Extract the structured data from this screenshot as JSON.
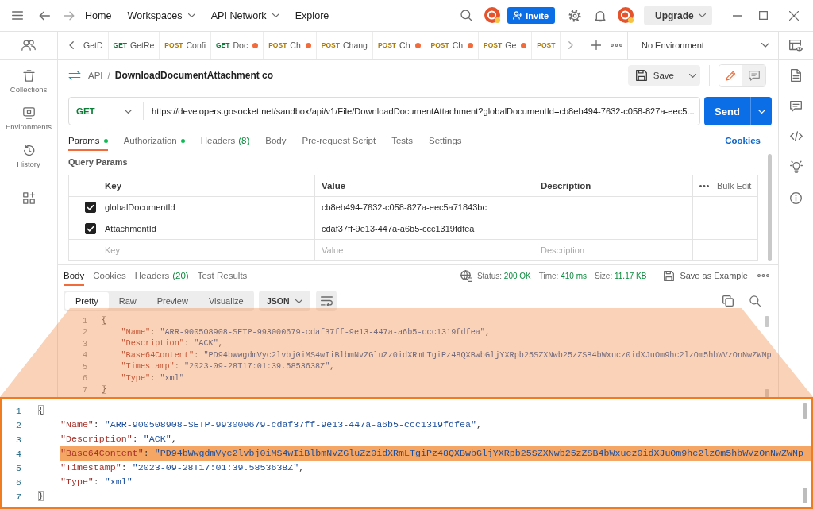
{
  "title_bar": {
    "nav": [
      {
        "label": "Home",
        "dropdown": false
      },
      {
        "label": "Workspaces",
        "dropdown": true
      },
      {
        "label": "API Network",
        "dropdown": true
      },
      {
        "label": "Explore",
        "dropdown": false
      }
    ],
    "invite_button": "Invite",
    "upgrade_button": "Upgrade"
  },
  "left_sidebar": {
    "items": [
      {
        "label": "Collections"
      },
      {
        "label": "Environments"
      },
      {
        "label": "History"
      }
    ]
  },
  "open_tabs": [
    {
      "name": "GetD",
      "modified": false
    },
    {
      "method": "GET",
      "kind": "get",
      "name": "GetRe",
      "modified": false
    },
    {
      "method": "POST",
      "kind": "post",
      "name": "Confi",
      "modified": false
    },
    {
      "method": "GET",
      "kind": "get",
      "name": "Doc",
      "modified": true
    },
    {
      "method": "POST",
      "kind": "post",
      "name": "Ch",
      "modified": true
    },
    {
      "method": "POST",
      "kind": "post",
      "name": "Chang",
      "modified": false
    },
    {
      "method": "POST",
      "kind": "post",
      "name": "Ch",
      "modified": true
    },
    {
      "method": "POST",
      "kind": "post",
      "name": "Ch",
      "modified": true
    },
    {
      "method": "POST",
      "kind": "post",
      "name": "Ge",
      "modified": true
    },
    {
      "method": "POST",
      "kind": "post",
      "modified": false
    }
  ],
  "environment": {
    "value": "No Environment"
  },
  "request": {
    "breadcrumb": {
      "parent": "API",
      "separator": "/",
      "name": "DownloadDocumentAttachment co"
    },
    "save_button": "Save",
    "mode_toggle": [
      {
        "selected": true
      },
      {
        "selected": false
      }
    ],
    "method": "GET",
    "url": "https://developers.gosocket.net/sandbox/api/v1/File/DownloadDocumentAttachment?globalDocumentId=cb8eb494-7632-c058-827a-eec5...",
    "send_button": "Send",
    "tabs": [
      {
        "label": "Params",
        "indicator": true,
        "selected": true
      },
      {
        "label": "Authorization",
        "indicator": true,
        "selected": false
      },
      {
        "label": "Headers",
        "count": "(8)",
        "indicator": false,
        "selected": false
      },
      {
        "label": "Body",
        "indicator": false,
        "selected": false
      },
      {
        "label": "Pre-request Script",
        "indicator": false,
        "selected": false
      },
      {
        "label": "Tests",
        "indicator": false,
        "selected": false
      },
      {
        "label": "Settings",
        "indicator": false,
        "selected": false
      }
    ],
    "cookies_link": "Cookies"
  },
  "query_params": {
    "title": "Query Params",
    "columns": [
      "Key",
      "Value",
      "Description"
    ],
    "bulk_edit": "Bulk Edit",
    "rows": [
      {
        "checked": true,
        "key": "globalDocumentId",
        "value": "cb8eb494-7632-c058-827a-eec5a71843bc"
      },
      {
        "checked": true,
        "key": "AttachmentId",
        "value": "cdaf37ff-9e13-447a-a6b5-ccc1319fdfea"
      }
    ],
    "new_row": {
      "key": {
        "placeholder": "Key"
      },
      "value": {
        "placeholder": "Value"
      },
      "description": {
        "placeholder": "Description"
      }
    }
  },
  "response": {
    "tabs": [
      {
        "label": "Body",
        "selected": true
      },
      {
        "label": "Cookies",
        "selected": false
      },
      {
        "label": "Headers",
        "count": "(20)",
        "selected": false
      },
      {
        "label": "Test Results",
        "selected": false
      }
    ],
    "status": [
      {
        "label": "Status:",
        "value": "200 OK"
      },
      {
        "label": "Time:",
        "value": "410 ms"
      },
      {
        "label": "Size:",
        "value": "11.17 KB"
      }
    ],
    "save_example": "Save as Example",
    "view_modes": [
      {
        "label": "Pretty",
        "selected": true
      },
      {
        "label": "Raw",
        "selected": false
      },
      {
        "label": "Preview",
        "selected": false
      },
      {
        "label": "Visualize",
        "selected": false
      }
    ],
    "format": "JSON",
    "lines": [
      {
        "number": "1",
        "segments": [
          {
            "kind": "brace",
            "text": "{"
          }
        ],
        "children": [
          {
            "number": "2",
            "segments": [
              {
                "kind": "key",
                "text": "\"Name\""
              },
              {
                "kind": "punct",
                "text": ": "
              },
              {
                "kind": "string",
                "text": "\"ARR-900508908-SETP-993000679-cdaf37ff-9e13-447a-a6b5-ccc1319fdfea\""
              },
              {
                "kind": "punct",
                "text": ","
              }
            ]
          },
          {
            "number": "3",
            "segments": [
              {
                "kind": "key",
                "text": "\"Description\""
              },
              {
                "kind": "punct",
                "text": ": "
              },
              {
                "kind": "string",
                "text": "\"ACK\""
              },
              {
                "kind": "punct",
                "text": ","
              }
            ]
          },
          {
            "number": "4",
            "segments": [
              {
                "kind": "key",
                "text": "\"Base64Content\""
              },
              {
                "kind": "punct",
                "text": ": "
              },
              {
                "kind": "string",
                "text": "\"PD94bWwgdmVyc2lvbj0iMS4wIiBlbmNvZGluZz0idXRmLTgiPz48QXBwbGljYXRpb25SZXNwb25zZSB4bWxucz0idXJuOm9hc2lzOm5hbWVzOnNwZWNp"
              }
            ]
          },
          {
            "number": "5",
            "segments": [
              {
                "kind": "key",
                "text": "\"Timestamp\""
              },
              {
                "kind": "punct",
                "text": ": "
              },
              {
                "kind": "string",
                "text": "\"2023-09-28T17:01:39.5853638Z\""
              },
              {
                "kind": "punct",
                "text": ","
              }
            ]
          },
          {
            "number": "6",
            "segments": [
              {
                "kind": "key",
                "text": "\"Type\""
              },
              {
                "kind": "punct",
                "text": ": "
              },
              {
                "kind": "string",
                "text": "\"xml\""
              }
            ]
          }
        ]
      },
      {
        "number": "7",
        "segments": [
          {
            "kind": "brace",
            "text": "}"
          }
        ]
      }
    ]
  },
  "zoom_callout": {
    "lines": [
      {
        "number": "1",
        "highlighted": false,
        "segments": [
          {
            "kind": "brace",
            "text": "{"
          }
        ],
        "children": [
          {
            "number": "2",
            "highlighted": false,
            "segments": [
              {
                "kind": "key",
                "text": "\"Name\""
              },
              {
                "kind": "punct",
                "text": ": "
              },
              {
                "kind": "string",
                "text": "\"ARR-900508908-SETP-993000679-cdaf37ff-9e13-447a-a6b5-ccc1319fdfea\""
              },
              {
                "kind": "punct",
                "text": ","
              }
            ]
          },
          {
            "number": "3",
            "highlighted": false,
            "segments": [
              {
                "kind": "key",
                "text": "\"Description\""
              },
              {
                "kind": "punct",
                "text": ": "
              },
              {
                "kind": "string",
                "text": "\"ACK\""
              },
              {
                "kind": "punct",
                "text": ","
              }
            ]
          },
          {
            "number": "4",
            "highlighted": true,
            "segments": [
              {
                "kind": "key",
                "text": "\"Base64Content\""
              },
              {
                "kind": "punct",
                "text": ": "
              },
              {
                "kind": "string",
                "text": "\"PD94bWwgdmVyc2lvbj0iMS4wIiBlbmNvZGluZz0idXRmLTgiPz48QXBwbGljYXRpb25SZXNwb25zZSB4bWxucz0idXJuOm9hc2lzOm5hbWVzOnNwZWNp"
              }
            ]
          },
          {
            "number": "5",
            "highlighted": false,
            "segments": [
              {
                "kind": "key",
                "text": "\"Timestamp\""
              },
              {
                "kind": "punct",
                "text": ": "
              },
              {
                "kind": "string",
                "text": "\"2023-09-28T17:01:39.5853638Z\""
              },
              {
                "kind": "punct",
                "text": ","
              }
            ]
          },
          {
            "number": "6",
            "highlighted": false,
            "segments": [
              {
                "kind": "key",
                "text": "\"Type\""
              },
              {
                "kind": "punct",
                "text": ": "
              },
              {
                "kind": "string",
                "text": "\"xml\""
              }
            ]
          }
        ]
      },
      {
        "number": "7",
        "highlighted": false,
        "segments": [
          {
            "kind": "brace",
            "text": "}"
          }
        ]
      }
    ]
  }
}
